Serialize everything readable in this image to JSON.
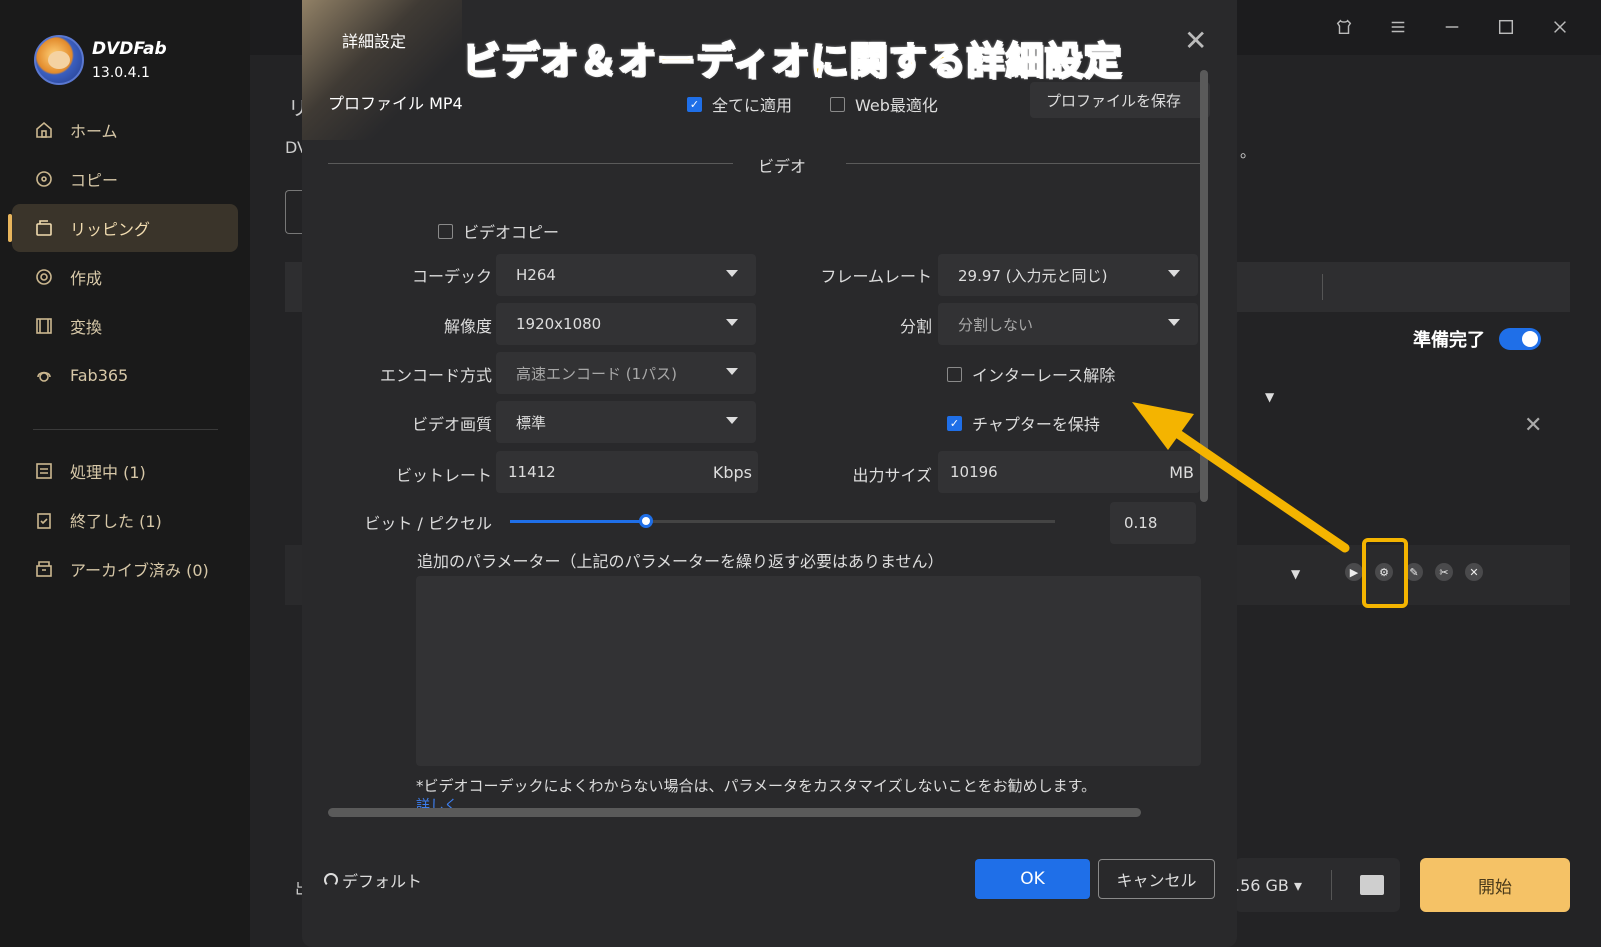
{
  "app": {
    "brand": "DVDFab",
    "version": "13.0.4.1"
  },
  "sidebar": {
    "items": [
      {
        "label": "ホーム",
        "icon": "home-icon"
      },
      {
        "label": "コピー",
        "icon": "copy-disc-icon"
      },
      {
        "label": "リッピング",
        "icon": "ripping-icon",
        "active": true
      },
      {
        "label": "作成",
        "icon": "create-disc-icon"
      },
      {
        "label": "変換",
        "icon": "convert-film-icon"
      },
      {
        "label": "Fab365",
        "icon": "fab365-icon"
      }
    ],
    "queue": [
      {
        "label": "処理中 (1)",
        "icon": "processing-list-icon"
      },
      {
        "label": "終了した (1)",
        "icon": "finished-clipboard-icon"
      },
      {
        "label": "アーカイブ済み (0)",
        "icon": "archive-box-icon"
      }
    ]
  },
  "background": {
    "page_title_fragment": "リ",
    "desc_fragment": "DV",
    "desc_end_fragment": "。",
    "ready_label": "準備完了",
    "ready_on": true,
    "storage_label": ".56 GB",
    "start_label": "開始",
    "bottom_fragment": "出"
  },
  "dialog": {
    "title": "詳細設定",
    "overlay_title": "ビデオ＆オーディオに関する詳細設定",
    "profile_label": "プロファイル MP4",
    "apply_all": {
      "label": "全てに適用",
      "checked": true
    },
    "web_opt": {
      "label": "Web最適化",
      "checked": false
    },
    "save_profile": "プロファイルを保存",
    "section_video": "ビデオ",
    "video_copy": {
      "label": "ビデオコピー",
      "checked": false
    },
    "codec": {
      "label": "コーデック",
      "value": "H264"
    },
    "resolution": {
      "label": "解像度",
      "value": "1920x1080"
    },
    "encode": {
      "label": "エンコード方式",
      "value": "高速エンコード (1パス)"
    },
    "quality": {
      "label": "ビデオ画質",
      "value": "標準"
    },
    "bitrate": {
      "label": "ビットレート",
      "value": "11412",
      "unit": "Kbps"
    },
    "framerate": {
      "label": "フレームレート",
      "value": "29.97 (入力元と同じ)"
    },
    "split": {
      "label": "分割",
      "value": "分割しない"
    },
    "deinterlace": {
      "label": "インターレース解除",
      "checked": false
    },
    "keep_chapters": {
      "label": "チャプターを保持",
      "checked": true
    },
    "output_size": {
      "label": "出力サイズ",
      "value": "10196",
      "unit": "MB"
    },
    "bits_per_pixel": {
      "label": "ビット / ピクセル",
      "value": "0.18",
      "slider_fraction": 0.25
    },
    "params_label": "追加のパラメーター（上記のパラメーターを繰り返す必要はありません）",
    "note": "*ビデオコーデックによくわからない場合は、パラメータをカスタマイズしないことをお勧めします。",
    "more_link": "詳しく",
    "default_label": "デフォルト",
    "ok": "OK",
    "cancel": "キャンセル"
  },
  "colors": {
    "accent": "#1f6fe8",
    "gold": "#f5c266",
    "highlight": "#f4b400"
  }
}
